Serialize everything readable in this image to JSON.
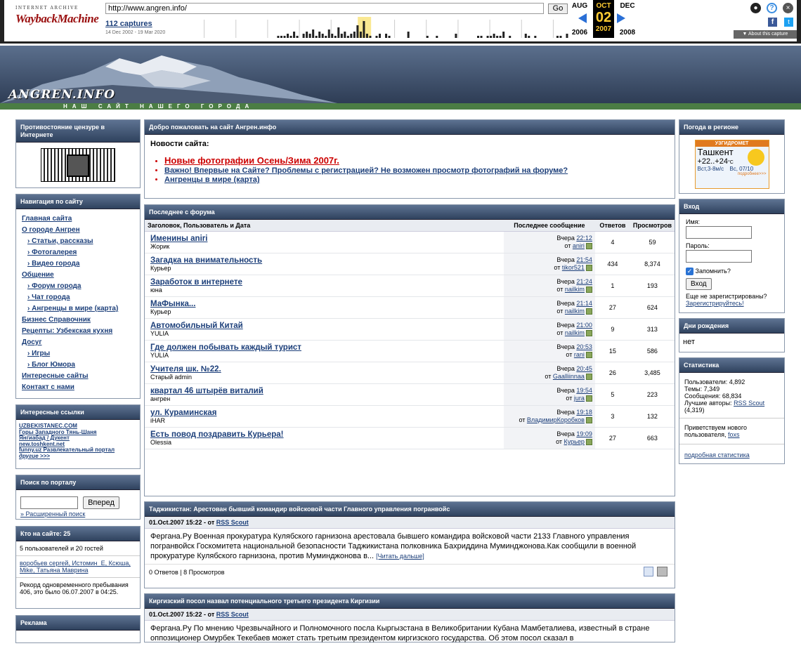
{
  "wayback": {
    "logo_top": "INTERNET ARCHIVE",
    "logo_main": "WaybackMachine",
    "url": "http://www.angren.info/",
    "go": "Go",
    "captures": "112 captures",
    "range": "14 Dec 2002 - 19 Mar 2020",
    "months": {
      "prev": "AUG",
      "cur": "OCT",
      "next": "DEC"
    },
    "day": "02",
    "years": {
      "prev": "2006",
      "cur": "2007",
      "next": "2008"
    },
    "about": "▼ About this capture",
    "sparkline": [
      0,
      0,
      0,
      0,
      0,
      0,
      0,
      0,
      0,
      0,
      0,
      0,
      0,
      0,
      0,
      0,
      0,
      0,
      0,
      0,
      0,
      0,
      0,
      0,
      0,
      0,
      0,
      0,
      1,
      1,
      1,
      2,
      1,
      3,
      1,
      0,
      2,
      3,
      2,
      4,
      1,
      3,
      2,
      1,
      4,
      2,
      1,
      5,
      2,
      3,
      1,
      2,
      3,
      6,
      3,
      8,
      2,
      1,
      0,
      1,
      2,
      0,
      2,
      1,
      0,
      0,
      0,
      0,
      0,
      3,
      0,
      0,
      0,
      0,
      0,
      1,
      0,
      0,
      1,
      0,
      0,
      0,
      0,
      0,
      2,
      0,
      0,
      0,
      0,
      0,
      0,
      1,
      1,
      0,
      1,
      1,
      2,
      1,
      1,
      3,
      0,
      1,
      0,
      0,
      0,
      0,
      2,
      1,
      0,
      1,
      0,
      0,
      0,
      0,
      0,
      0,
      1,
      1,
      0,
      2
    ]
  },
  "site": {
    "title": "ANGREN.INFO",
    "tagline": "НАШ САЙТ НАШЕГО ГОРОДА"
  },
  "left": {
    "censor_title": "Противостояние цензуре в Интернете",
    "nav_title": "Навигация по сайту",
    "nav": [
      {
        "label": "Главная сайта",
        "sub": false
      },
      {
        "label": "О городе Ангрен",
        "sub": false
      },
      {
        "label": "› Статьи, рассказы",
        "sub": true
      },
      {
        "label": "› Фотогалерея",
        "sub": true
      },
      {
        "label": "› Видео города",
        "sub": true
      },
      {
        "label": "Общение",
        "sub": false
      },
      {
        "label": "› Форум города",
        "sub": true
      },
      {
        "label": "› Чат города",
        "sub": true
      },
      {
        "label": "› Ангренцы в мире (карта)",
        "sub": true
      },
      {
        "label": "Бизнес Справочник",
        "sub": false
      },
      {
        "label": "Рецепты: Узбекская кухня",
        "sub": false
      },
      {
        "label": "Досуг",
        "sub": false
      },
      {
        "label": "› Игры",
        "sub": true
      },
      {
        "label": "› Блог Юмора",
        "sub": true
      },
      {
        "label": "Интересные сайты",
        "sub": false
      },
      {
        "label": "Контакт с нами",
        "sub": false
      }
    ],
    "links_title": "Интересные ссылки",
    "links": [
      "UZBEKISTANEC.COM",
      "Горы Западного Тянь-Шаня",
      "Янгиабад / Дукент",
      "new.toshkent.net",
      "funny.uz Развлекательный портал",
      "другие >>>"
    ],
    "search_title": "Поиск по порталу",
    "search_btn": "Вперед",
    "search_adv": "» Расширенный поиск",
    "who_title": "Кто на сайте: 25",
    "who_line": "5 пользователей и 20 гостей",
    "who_users": "воробьев сергей, Истомин_Е, Ксюша, Mike, Татьяна Маврина",
    "record": "Рекорд одновременного пребывания 406, это было 06.07.2007 в 04:25.",
    "ads_title": "Реклама"
  },
  "welcome": {
    "title": "Добро пожаловать на сайт Ангрен.инфо",
    "heading": "Новости сайта:",
    "items": [
      "Новые фотографии Осень/Зима 2007г.",
      "Важно! Впервые на Сайте? Проблемы с регистрацией? Не возможен просмотр фотографий на форуме?",
      "Ангренцы в мире (карта)"
    ]
  },
  "forum": {
    "title": "Последнее с форума",
    "headers": [
      "Заголовок, Пользователь и Дата",
      "Последнее сообщение",
      "Ответов",
      "Просмотров"
    ],
    "rows": [
      {
        "t": "Именины aniri",
        "u": "Жорик",
        "d": "Вчера",
        "tm": "22:12",
        "by": "aniri",
        "r": "4",
        "v": "59"
      },
      {
        "t": "Загадка на внимательность",
        "u": "Курьер",
        "d": "Вчера",
        "tm": "21:54",
        "by": "tikor521",
        "r": "434",
        "v": "8,374"
      },
      {
        "t": "Заработок в интернете",
        "u": "юна",
        "d": "Вчера",
        "tm": "21:24",
        "by": "nailkim",
        "r": "1",
        "v": "193"
      },
      {
        "t": "МаФынка...",
        "u": "Курьер",
        "d": "Вчера",
        "tm": "21:14",
        "by": "nailkim",
        "r": "27",
        "v": "624"
      },
      {
        "t": "Автомобильный Китай",
        "u": "YULIA",
        "d": "Вчера",
        "tm": "21:00",
        "by": "nailkim",
        "r": "9",
        "v": "313"
      },
      {
        "t": "Где должен побывать каждый турист",
        "u": "YULIA",
        "d": "Вчера",
        "tm": "20:53",
        "by": "rani",
        "r": "15",
        "v": "586"
      },
      {
        "t": "Учителя шк. №22.",
        "u": "Старый admin",
        "d": "Вчера",
        "tm": "20:45",
        "by": "Gaalliinnaa",
        "r": "26",
        "v": "3,485"
      },
      {
        "t": "квартал 46 штырёв виталий",
        "u": "ангрен",
        "d": "Вчера",
        "tm": "19:54",
        "by": "jura",
        "r": "5",
        "v": "223"
      },
      {
        "t": "ул. Кураминская",
        "u": "iHAR",
        "d": "Вчера",
        "tm": "19:18",
        "by": "ВладимирКоробков",
        "r": "3",
        "v": "132"
      },
      {
        "t": "Есть повод поздравить Курьера!",
        "u": "Olessia",
        "d": "Вчера",
        "tm": "19:09",
        "by": "Курьер",
        "r": "27",
        "v": "663"
      }
    ],
    "from": "от"
  },
  "news1": {
    "title": "Таджикистан: Арестован бывший командир войсковой части Главного управления погранвойс",
    "meta": "01.Oct.2007 15:22 - от",
    "author": "RSS Scout",
    "body": "Фергана.Ру Военная прокуратура Кулябского гарнизона арестовала бывшего командира войсковой части 2133 Главного управления погранвойск Госкомитета национальной безопасности Таджикистана полковника Бахриддина Муминджонова.Как сообщили в военной прокуратуре Кулябского гарнизона, против Муминджонова в... ",
    "more": "[Читать дальше]",
    "stats": "0 Ответов | 8 Просмотров"
  },
  "news2": {
    "title": "Киргизский посол назвал потенциального третьего президента Киргизии",
    "meta": "01.Oct.2007 15:22 - от",
    "author": "RSS Scout",
    "body": "Фергана.Ру По мнению Чрезвычайного и Полномочного посла Кыргызстана в Великобритании Кубана Мамбеталиева, известный в стране оппозиционер Омурбек Текебаев может стать третьим президентом киргизского государства. Об этом посол сказал в"
  },
  "right": {
    "weather_title": "Погода в регионе",
    "weather_brand": "УЗГИДРОМЕТ",
    "weather_city": "Ташкент",
    "weather_temp": "+22..+24",
    "weather_unit": "°C",
    "weather_wind": "Вст,3-8м/с",
    "weather_date": "Вс, 07/10",
    "weather_more": "подробнее>>>",
    "login_title": "Вход",
    "login_name": "Имя:",
    "login_pass": "Пароль:",
    "remember": "Запомнить?",
    "login_btn": "Вход",
    "not_reg": "Еще не зарегистрированы?",
    "register": "Зарегистрируйтесь!",
    "bday_title": "Дни рождения",
    "bday": "нет",
    "stats_title": "Статистика",
    "stats": [
      "Пользователи: 4,892",
      "Темы: 7,349",
      "Сообщения: 68,834"
    ],
    "best": "Лучшие авторы:",
    "best_user": "RSS Scout",
    "best_count": "(4,319)",
    "welcome_new": "Приветствуем нового пользователя,",
    "new_user": "foxs",
    "more_stats": "подробная статистика"
  }
}
